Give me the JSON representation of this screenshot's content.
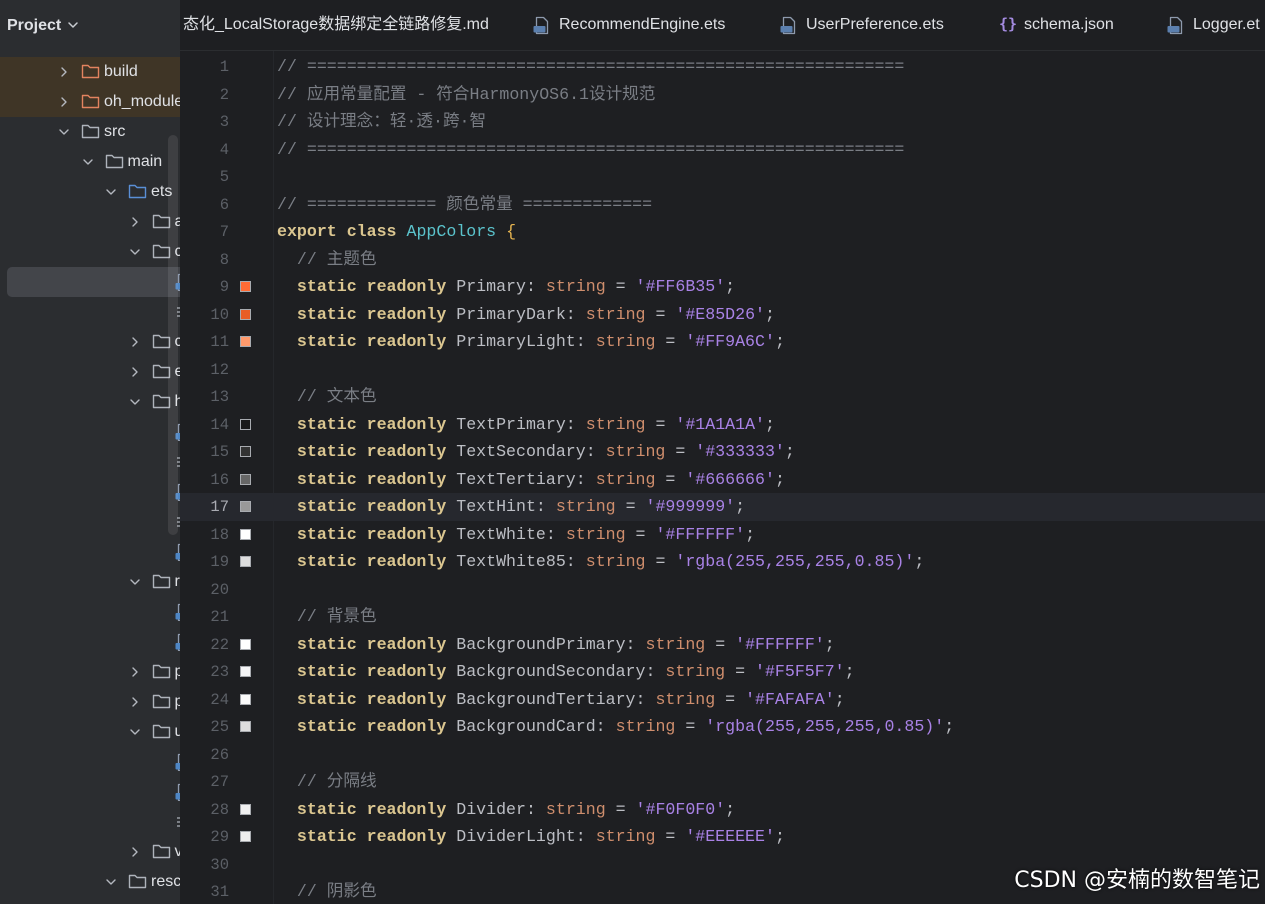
{
  "theme": {
    "keyword": "#DBC690",
    "class_name": "#5BC3CC",
    "brace": "#E6B450",
    "comment": "#7A7E85",
    "type": "#CF8E6D",
    "string": "#A982E6",
    "text": "#BCBEC4"
  },
  "project_panel": {
    "title": "Project",
    "tree": [
      {
        "label": "build",
        "kind": "folder",
        "depth": 0,
        "expanded": false,
        "state": "excluded"
      },
      {
        "label": "oh_module",
        "kind": "folder",
        "depth": 0,
        "expanded": false,
        "state": "excluded"
      },
      {
        "label": "src",
        "kind": "folder",
        "depth": 0,
        "expanded": true
      },
      {
        "label": "main",
        "kind": "folder",
        "depth": 1,
        "expanded": true
      },
      {
        "label": "ets",
        "kind": "source-folder",
        "depth": 2,
        "expanded": true
      },
      {
        "label": "a",
        "kind": "folder",
        "depth": 3,
        "expanded": false
      },
      {
        "label": "c",
        "kind": "folder",
        "depth": 3,
        "expanded": true
      },
      {
        "kind": "ets-file",
        "depth": 4,
        "selected": true
      },
      {
        "kind": "text-file",
        "depth": 4
      },
      {
        "label": "c",
        "kind": "folder",
        "depth": 3,
        "expanded": false
      },
      {
        "label": "e",
        "kind": "folder",
        "depth": 3,
        "expanded": false
      },
      {
        "label": "h",
        "kind": "folder",
        "depth": 3,
        "expanded": true
      },
      {
        "kind": "ets-file",
        "depth": 4
      },
      {
        "kind": "text-file",
        "depth": 4
      },
      {
        "kind": "ets-file",
        "depth": 4
      },
      {
        "kind": "text-file",
        "depth": 4
      },
      {
        "kind": "ets-file",
        "depth": 4
      },
      {
        "label": "r",
        "kind": "folder",
        "depth": 3,
        "expanded": true
      },
      {
        "kind": "ets-file",
        "depth": 4
      },
      {
        "kind": "ets-file",
        "depth": 4
      },
      {
        "label": "p",
        "kind": "folder",
        "depth": 3,
        "expanded": false
      },
      {
        "label": "p",
        "kind": "folder",
        "depth": 3,
        "expanded": false
      },
      {
        "label": "u",
        "kind": "folder",
        "depth": 3,
        "expanded": true
      },
      {
        "kind": "ets-file",
        "depth": 4
      },
      {
        "kind": "ets-file",
        "depth": 4
      },
      {
        "kind": "text-file",
        "depth": 4
      },
      {
        "label": "v",
        "kind": "folder",
        "depth": 3,
        "expanded": false
      },
      {
        "label": "resc",
        "kind": "folder",
        "depth": 2,
        "expanded": true
      }
    ]
  },
  "tabs": [
    {
      "label": "态化_LocalStorage数据绑定全链路修复.md"
    },
    {
      "label": "RecommendEngine.ets",
      "icon": "ets-file-icon"
    },
    {
      "label": "UserPreference.ets",
      "icon": "ets-file-icon"
    },
    {
      "label": "schema.json",
      "icon": "json-file-icon",
      "glyph": "{}"
    },
    {
      "label": "Logger.et",
      "icon": "ets-file-icon"
    }
  ],
  "editor": {
    "current_line": "17",
    "lines": [
      {
        "n": "1",
        "tokens": [
          [
            "c",
            "// ============================================================"
          ]
        ]
      },
      {
        "n": "2",
        "tokens": [
          [
            "c",
            "// 应用常量配置 - 符合HarmonyOS6.1设计规范"
          ]
        ]
      },
      {
        "n": "3",
        "tokens": [
          [
            "c",
            "// 设计理念：轻·透·跨·智"
          ]
        ]
      },
      {
        "n": "4",
        "tokens": [
          [
            "c",
            "// ============================================================"
          ]
        ]
      },
      {
        "n": "5",
        "tokens": []
      },
      {
        "n": "6",
        "tokens": [
          [
            "c",
            "// ============= 颜色常量 ============="
          ]
        ]
      },
      {
        "n": "7",
        "tokens": [
          [
            "k",
            "export"
          ],
          [
            "p",
            " "
          ],
          [
            "k",
            "class"
          ],
          [
            "p",
            " "
          ],
          [
            "cls",
            "AppColors"
          ],
          [
            "p",
            " "
          ],
          [
            "b",
            "{"
          ]
        ]
      },
      {
        "n": "8",
        "tokens": [
          [
            "p",
            "  "
          ],
          [
            "c",
            "// 主题色"
          ]
        ]
      },
      {
        "n": "9",
        "swatch": "#FF6B35",
        "tokens": [
          [
            "p",
            "  "
          ],
          [
            "k",
            "static"
          ],
          [
            "p",
            " "
          ],
          [
            "k",
            "readonly"
          ],
          [
            "p",
            " Primary: "
          ],
          [
            "t",
            "string"
          ],
          [
            "p",
            " = "
          ],
          [
            "s",
            "'#FF6B35'"
          ],
          [
            "p",
            ";"
          ]
        ]
      },
      {
        "n": "10",
        "swatch": "#E85D26",
        "tokens": [
          [
            "p",
            "  "
          ],
          [
            "k",
            "static"
          ],
          [
            "p",
            " "
          ],
          [
            "k",
            "readonly"
          ],
          [
            "p",
            " PrimaryDark: "
          ],
          [
            "t",
            "string"
          ],
          [
            "p",
            " = "
          ],
          [
            "s",
            "'#E85D26'"
          ],
          [
            "p",
            ";"
          ]
        ]
      },
      {
        "n": "11",
        "swatch": "#FF9A6C",
        "tokens": [
          [
            "p",
            "  "
          ],
          [
            "k",
            "static"
          ],
          [
            "p",
            " "
          ],
          [
            "k",
            "readonly"
          ],
          [
            "p",
            " PrimaryLight: "
          ],
          [
            "t",
            "string"
          ],
          [
            "p",
            " = "
          ],
          [
            "s",
            "'#FF9A6C'"
          ],
          [
            "p",
            ";"
          ]
        ]
      },
      {
        "n": "12",
        "tokens": []
      },
      {
        "n": "13",
        "tokens": [
          [
            "p",
            "  "
          ],
          [
            "c",
            "// 文本色"
          ]
        ]
      },
      {
        "n": "14",
        "swatch": "#1A1A1A",
        "tokens": [
          [
            "p",
            "  "
          ],
          [
            "k",
            "static"
          ],
          [
            "p",
            " "
          ],
          [
            "k",
            "readonly"
          ],
          [
            "p",
            " TextPrimary: "
          ],
          [
            "t",
            "string"
          ],
          [
            "p",
            " = "
          ],
          [
            "s",
            "'#1A1A1A'"
          ],
          [
            "p",
            ";"
          ]
        ]
      },
      {
        "n": "15",
        "swatch": "#333333",
        "tokens": [
          [
            "p",
            "  "
          ],
          [
            "k",
            "static"
          ],
          [
            "p",
            " "
          ],
          [
            "k",
            "readonly"
          ],
          [
            "p",
            " TextSecondary: "
          ],
          [
            "t",
            "string"
          ],
          [
            "p",
            " = "
          ],
          [
            "s",
            "'#333333'"
          ],
          [
            "p",
            ";"
          ]
        ]
      },
      {
        "n": "16",
        "swatch": "#666666",
        "tokens": [
          [
            "p",
            "  "
          ],
          [
            "k",
            "static"
          ],
          [
            "p",
            " "
          ],
          [
            "k",
            "readonly"
          ],
          [
            "p",
            " TextTertiary: "
          ],
          [
            "t",
            "string"
          ],
          [
            "p",
            " = "
          ],
          [
            "s",
            "'#666666'"
          ],
          [
            "p",
            ";"
          ]
        ]
      },
      {
        "n": "17",
        "swatch": "#999999",
        "tokens": [
          [
            "p",
            "  "
          ],
          [
            "k",
            "static"
          ],
          [
            "p",
            " "
          ],
          [
            "k",
            "readonly"
          ],
          [
            "p",
            " TextHint: "
          ],
          [
            "t",
            "string"
          ],
          [
            "p",
            " = "
          ],
          [
            "s",
            "'#999999'"
          ],
          [
            "p",
            ";"
          ]
        ]
      },
      {
        "n": "18",
        "swatch": "#FFFFFF",
        "tokens": [
          [
            "p",
            "  "
          ],
          [
            "k",
            "static"
          ],
          [
            "p",
            " "
          ],
          [
            "k",
            "readonly"
          ],
          [
            "p",
            " TextWhite: "
          ],
          [
            "t",
            "string"
          ],
          [
            "p",
            " = "
          ],
          [
            "s",
            "'#FFFFFF'"
          ],
          [
            "p",
            ";"
          ]
        ]
      },
      {
        "n": "19",
        "swatch": "rgba(255,255,255,0.85)",
        "tokens": [
          [
            "p",
            "  "
          ],
          [
            "k",
            "static"
          ],
          [
            "p",
            " "
          ],
          [
            "k",
            "readonly"
          ],
          [
            "p",
            " TextWhite85: "
          ],
          [
            "t",
            "string"
          ],
          [
            "p",
            " = "
          ],
          [
            "s",
            "'rgba(255,255,255,0.85)'"
          ],
          [
            "p",
            ";"
          ]
        ]
      },
      {
        "n": "20",
        "tokens": []
      },
      {
        "n": "21",
        "tokens": [
          [
            "p",
            "  "
          ],
          [
            "c",
            "// 背景色"
          ]
        ]
      },
      {
        "n": "22",
        "swatch": "#FFFFFF",
        "tokens": [
          [
            "p",
            "  "
          ],
          [
            "k",
            "static"
          ],
          [
            "p",
            " "
          ],
          [
            "k",
            "readonly"
          ],
          [
            "p",
            " BackgroundPrimary: "
          ],
          [
            "t",
            "string"
          ],
          [
            "p",
            " = "
          ],
          [
            "s",
            "'#FFFFFF'"
          ],
          [
            "p",
            ";"
          ]
        ]
      },
      {
        "n": "23",
        "swatch": "#F5F5F7",
        "tokens": [
          [
            "p",
            "  "
          ],
          [
            "k",
            "static"
          ],
          [
            "p",
            " "
          ],
          [
            "k",
            "readonly"
          ],
          [
            "p",
            " BackgroundSecondary: "
          ],
          [
            "t",
            "string"
          ],
          [
            "p",
            " = "
          ],
          [
            "s",
            "'#F5F5F7'"
          ],
          [
            "p",
            ";"
          ]
        ]
      },
      {
        "n": "24",
        "swatch": "#FAFAFA",
        "tokens": [
          [
            "p",
            "  "
          ],
          [
            "k",
            "static"
          ],
          [
            "p",
            " "
          ],
          [
            "k",
            "readonly"
          ],
          [
            "p",
            " BackgroundTertiary: "
          ],
          [
            "t",
            "string"
          ],
          [
            "p",
            " = "
          ],
          [
            "s",
            "'#FAFAFA'"
          ],
          [
            "p",
            ";"
          ]
        ]
      },
      {
        "n": "25",
        "swatch": "rgba(255,255,255,0.85)",
        "tokens": [
          [
            "p",
            "  "
          ],
          [
            "k",
            "static"
          ],
          [
            "p",
            " "
          ],
          [
            "k",
            "readonly"
          ],
          [
            "p",
            " BackgroundCard: "
          ],
          [
            "t",
            "string"
          ],
          [
            "p",
            " = "
          ],
          [
            "s",
            "'rgba(255,255,255,0.85)'"
          ],
          [
            "p",
            ";"
          ]
        ]
      },
      {
        "n": "26",
        "tokens": []
      },
      {
        "n": "27",
        "tokens": [
          [
            "p",
            "  "
          ],
          [
            "c",
            "// 分隔线"
          ]
        ]
      },
      {
        "n": "28",
        "swatch": "#F0F0F0",
        "tokens": [
          [
            "p",
            "  "
          ],
          [
            "k",
            "static"
          ],
          [
            "p",
            " "
          ],
          [
            "k",
            "readonly"
          ],
          [
            "p",
            " Divider: "
          ],
          [
            "t",
            "string"
          ],
          [
            "p",
            " = "
          ],
          [
            "s",
            "'#F0F0F0'"
          ],
          [
            "p",
            ";"
          ]
        ]
      },
      {
        "n": "29",
        "swatch": "#EEEEEE",
        "tokens": [
          [
            "p",
            "  "
          ],
          [
            "k",
            "static"
          ],
          [
            "p",
            " "
          ],
          [
            "k",
            "readonly"
          ],
          [
            "p",
            " DividerLight: "
          ],
          [
            "t",
            "string"
          ],
          [
            "p",
            " = "
          ],
          [
            "s",
            "'#EEEEEE'"
          ],
          [
            "p",
            ";"
          ]
        ]
      },
      {
        "n": "30",
        "tokens": []
      },
      {
        "n": "31",
        "tokens": [
          [
            "p",
            "  "
          ],
          [
            "c",
            "// 阴影色"
          ]
        ]
      }
    ]
  },
  "watermark": "CSDN @安楠的数智笔记"
}
